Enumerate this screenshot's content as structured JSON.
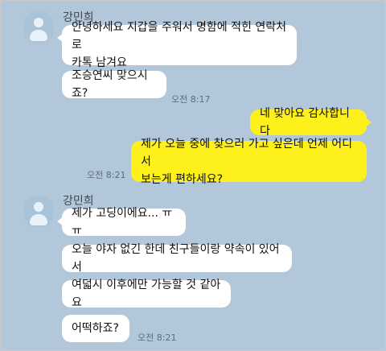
{
  "colors": {
    "background": "#b2c7d9",
    "incoming_bubble": "#ffffff",
    "outgoing_bubble": "#fef01b"
  },
  "icons": {
    "avatar": "default-profile-icon"
  },
  "chat": {
    "group1": {
      "sender": "강민희",
      "messages": [
        "안녕하세요 지갑을 주워서 명함에 적힌 연락처로\n카톡 남겨요",
        "조승연씨 맞으시죠?"
      ],
      "time": "오전 8:17"
    },
    "outgoing": {
      "messages": [
        "네 맞아요 감사합니다",
        "제가 오늘 중에 찾으러 가고 싶은데 언제 어디서\n보는게 편하세요?"
      ],
      "time": "오전 8:21"
    },
    "group2": {
      "sender": "강민희",
      "messages": [
        "제가 고딩이에요... ㅠㅠ",
        "오늘 야자 없긴 한데 친구들이랑 약속이 있어서",
        "여덟시 이후에만 가능할 것 같아요",
        "어떡하죠?"
      ],
      "time": "오전 8:21"
    }
  }
}
